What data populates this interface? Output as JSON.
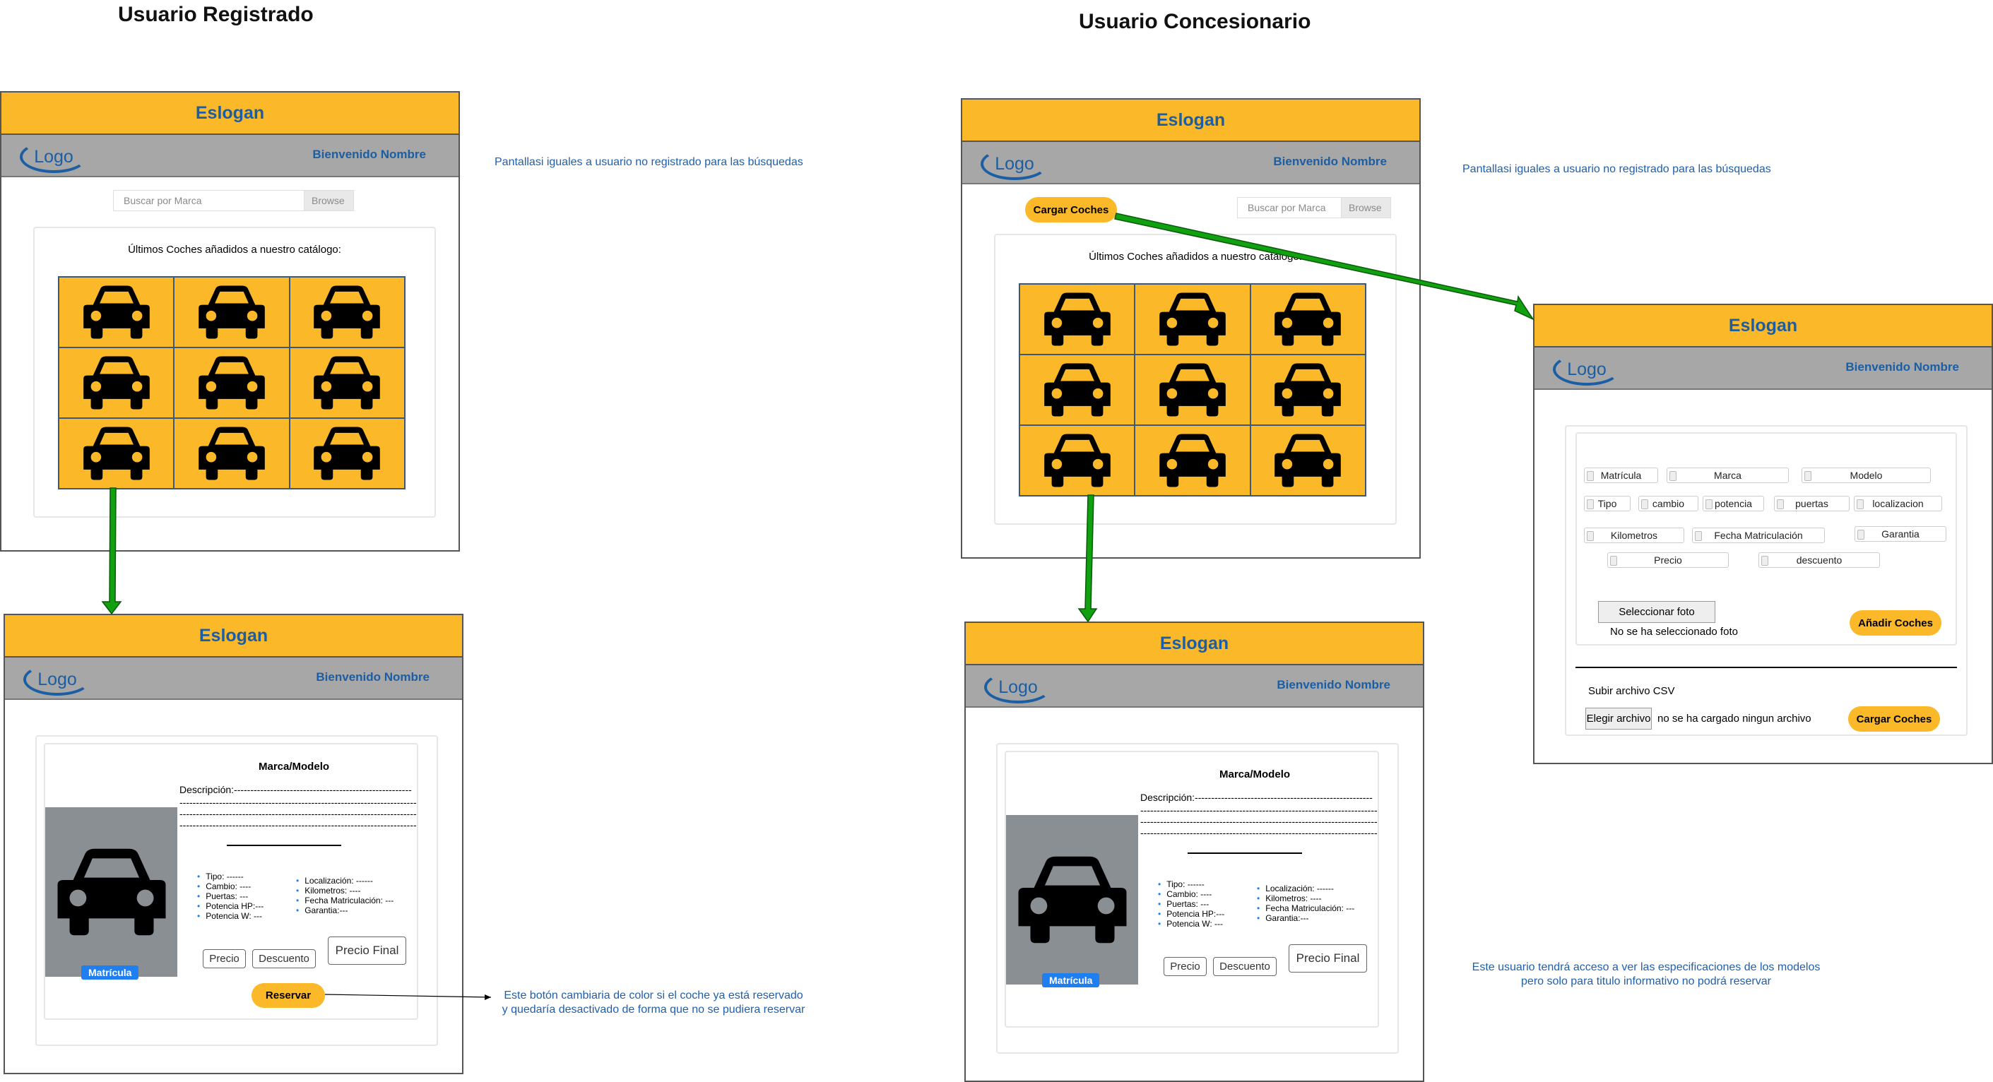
{
  "titles": {
    "left": "Usuario Registrado",
    "right": "Usuario Concesionario"
  },
  "common": {
    "slogan": "Eslogan",
    "logo": "Logo",
    "welcome": "Bienvenido Nombre",
    "search_placeholder": "Buscar por Marca",
    "browse": "Browse",
    "catalog_caption": "Últimos Coches añadidos a nuestro catálogo:"
  },
  "notes": {
    "same_screens_left": "Pantallasi iguales a usuario no registrado  para las búsquedas",
    "same_screens_right": "Pantallasi iguales a usuario no registrado  para las búsquedas",
    "reserve_note_line1": "Este botón cambiaria de color si el coche ya está reservado",
    "reserve_note_line2": "y quedaría desactivado de forma que no se pudiera reservar",
    "dealer_note_line1": "Este usuario tendrá acceso a ver las especificaciones de los modelos",
    "dealer_note_line2": "pero solo para titulo informativo  no podrá reservar"
  },
  "dealer_catalog": {
    "load_button": "Cargar Coches",
    "catalog_caption": "Últimos Coches añadidos a nuestro catálogo:"
  },
  "detail": {
    "brand_model": "Marca/Modelo",
    "description": "Descripción:------------------------------------------------------",
    "dash_line": "-------------------------------------------------------------------------------",
    "plate_badge": "Matrícula",
    "specs_left": [
      "Tipo: ------",
      "Cambio: ----",
      "Puertas: ---",
      "Potencia HP:---",
      "Potencia W: ---"
    ],
    "specs_right": [
      "Localización: ------",
      "Kilometros: ----",
      "Fecha Matriculación: ---",
      "Garantia:---"
    ],
    "price": "Precio",
    "discount": "Descuento",
    "final_price": "Precio Final",
    "reserve_button": "Reservar"
  },
  "add_form": {
    "row1": [
      "Matrícula",
      "Marca",
      "Modelo"
    ],
    "row2": [
      "Tipo",
      "cambio",
      "potencia",
      "puertas",
      "localizacion"
    ],
    "row3": [
      "Kilometros",
      "Fecha Matriculación",
      "Garantia"
    ],
    "row4": [
      "Precio",
      "descuento"
    ],
    "select_photo": "Seleccionar foto",
    "no_photo": "No se ha seleccionado foto",
    "add_button": "Añadir Coches",
    "csv_label": "Subir archivo CSV",
    "choose_file": "Elegir archivo",
    "no_file": "no se ha cargado ningun archivo",
    "load_button": "Cargar Coches"
  },
  "colors": {
    "accent": "#fbb829",
    "brand_blue": "#1b5ea3",
    "header_gray": "#a7a7a7",
    "arrow_green": "#10a010"
  },
  "icons": {
    "car": "car-icon",
    "logo": "logo-ellipse"
  }
}
